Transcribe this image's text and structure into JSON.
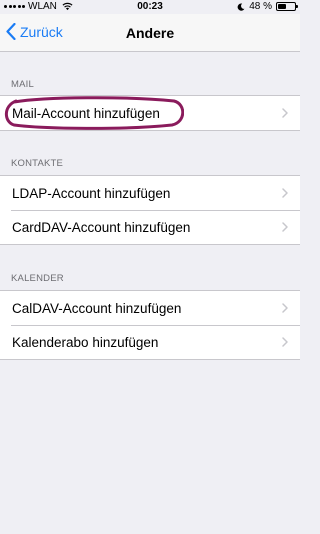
{
  "status_bar": {
    "carrier": "WLAN",
    "time": "00:23",
    "battery_percent": "48 %",
    "battery_level": 0.48
  },
  "nav": {
    "back_label": "Zurück",
    "title": "Andere"
  },
  "sections": {
    "mail": {
      "header": "MAIL",
      "items": [
        {
          "label": "Mail-Account hinzufügen"
        }
      ]
    },
    "contacts": {
      "header": "KONTAKTE",
      "items": [
        {
          "label": "LDAP-Account hinzufügen"
        },
        {
          "label": "CardDAV-Account hinzufügen"
        }
      ]
    },
    "calendar": {
      "header": "KALENDER",
      "items": [
        {
          "label": "CalDAV-Account hinzufügen"
        },
        {
          "label": "Kalenderabo hinzufügen"
        }
      ]
    }
  },
  "icons": {
    "back": "chevron-left-icon",
    "row_disclosure": "chevron-right-icon",
    "wifi": "wifi-icon",
    "moon": "moon-icon",
    "battery": "battery-icon"
  },
  "colors": {
    "accent": "#1a7cf5",
    "annotation": "#8a1b5c",
    "background": "#efeff4"
  }
}
